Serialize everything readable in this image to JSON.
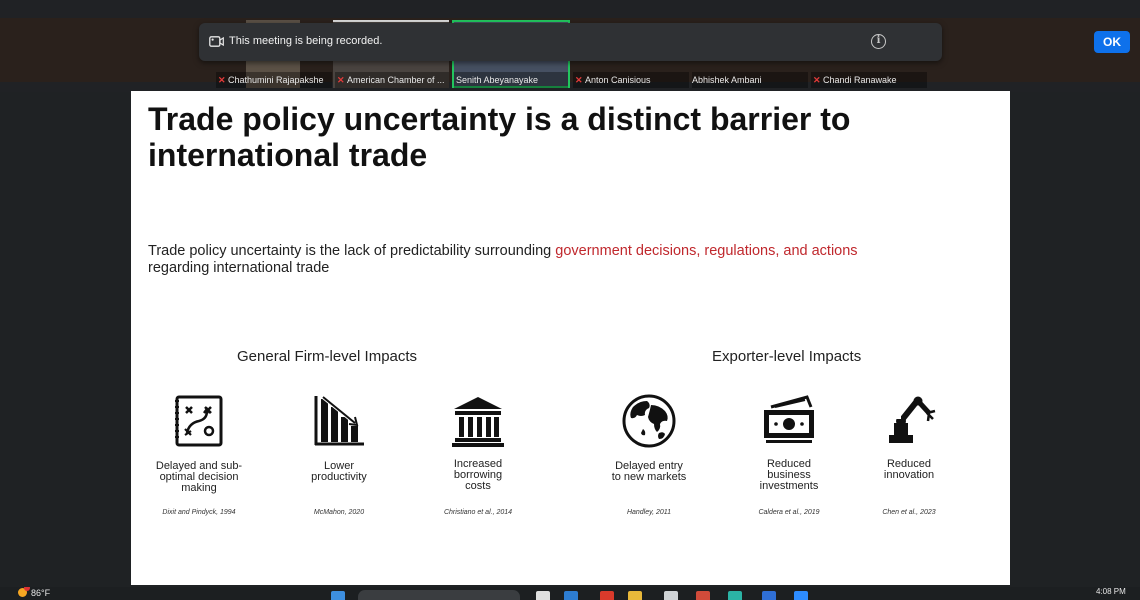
{
  "meeting": {
    "banner_text": "This meeting is being recorded.",
    "ok_label": "OK",
    "participants": [
      {
        "name": "Chathumini Rajapakshe",
        "muted": true
      },
      {
        "name": "American Chamber of ...",
        "muted": true
      },
      {
        "name": "Senith Abeyanayake",
        "muted": false
      },
      {
        "name": "Anton Canisious",
        "muted": true
      },
      {
        "name": "Abhishek Ambani",
        "muted": false
      },
      {
        "name": "Chandi Ranawake",
        "muted": true
      }
    ]
  },
  "slide": {
    "title": "Trade policy uncertainty is a distinct barrier to international trade",
    "definition_prefix": "Trade policy uncertainty is the lack of predictability surrounding ",
    "definition_highlight": "government decisions, regulations, and actions",
    "definition_suffix": "regarding international trade",
    "sections": {
      "firm": "General Firm-level Impacts",
      "exporter": "Exporter-level Impacts"
    },
    "impacts": [
      {
        "icon": "strategy-board-icon",
        "label": "Delayed and sub-\noptimal decision\nmaking",
        "citation": "Dixit and Pindyck, 1994"
      },
      {
        "icon": "declining-bar-chart-icon",
        "label": "Lower\nproductivity",
        "citation": "McMahon, 2020"
      },
      {
        "icon": "bank-building-icon",
        "label": "Increased\nborrowing\ncosts",
        "citation": "Christiano et al., 2014"
      },
      {
        "icon": "globe-icon",
        "label": "Delayed entry\nto new markets",
        "citation": "Handley, 2011"
      },
      {
        "icon": "banknotes-icon",
        "label": "Reduced\nbusiness\ninvestments",
        "citation": "Caldera et al., 2019"
      },
      {
        "icon": "robotic-arm-icon",
        "label": "Reduced\ninnovation",
        "citation": "Chen et al., 2023"
      }
    ]
  },
  "taskbar": {
    "temperature": "86°F",
    "time": "4:08 PM"
  },
  "colors": {
    "highlight": "#c0282d",
    "ok_button": "#0e71eb",
    "active_speaker_border": "#22c55e"
  }
}
